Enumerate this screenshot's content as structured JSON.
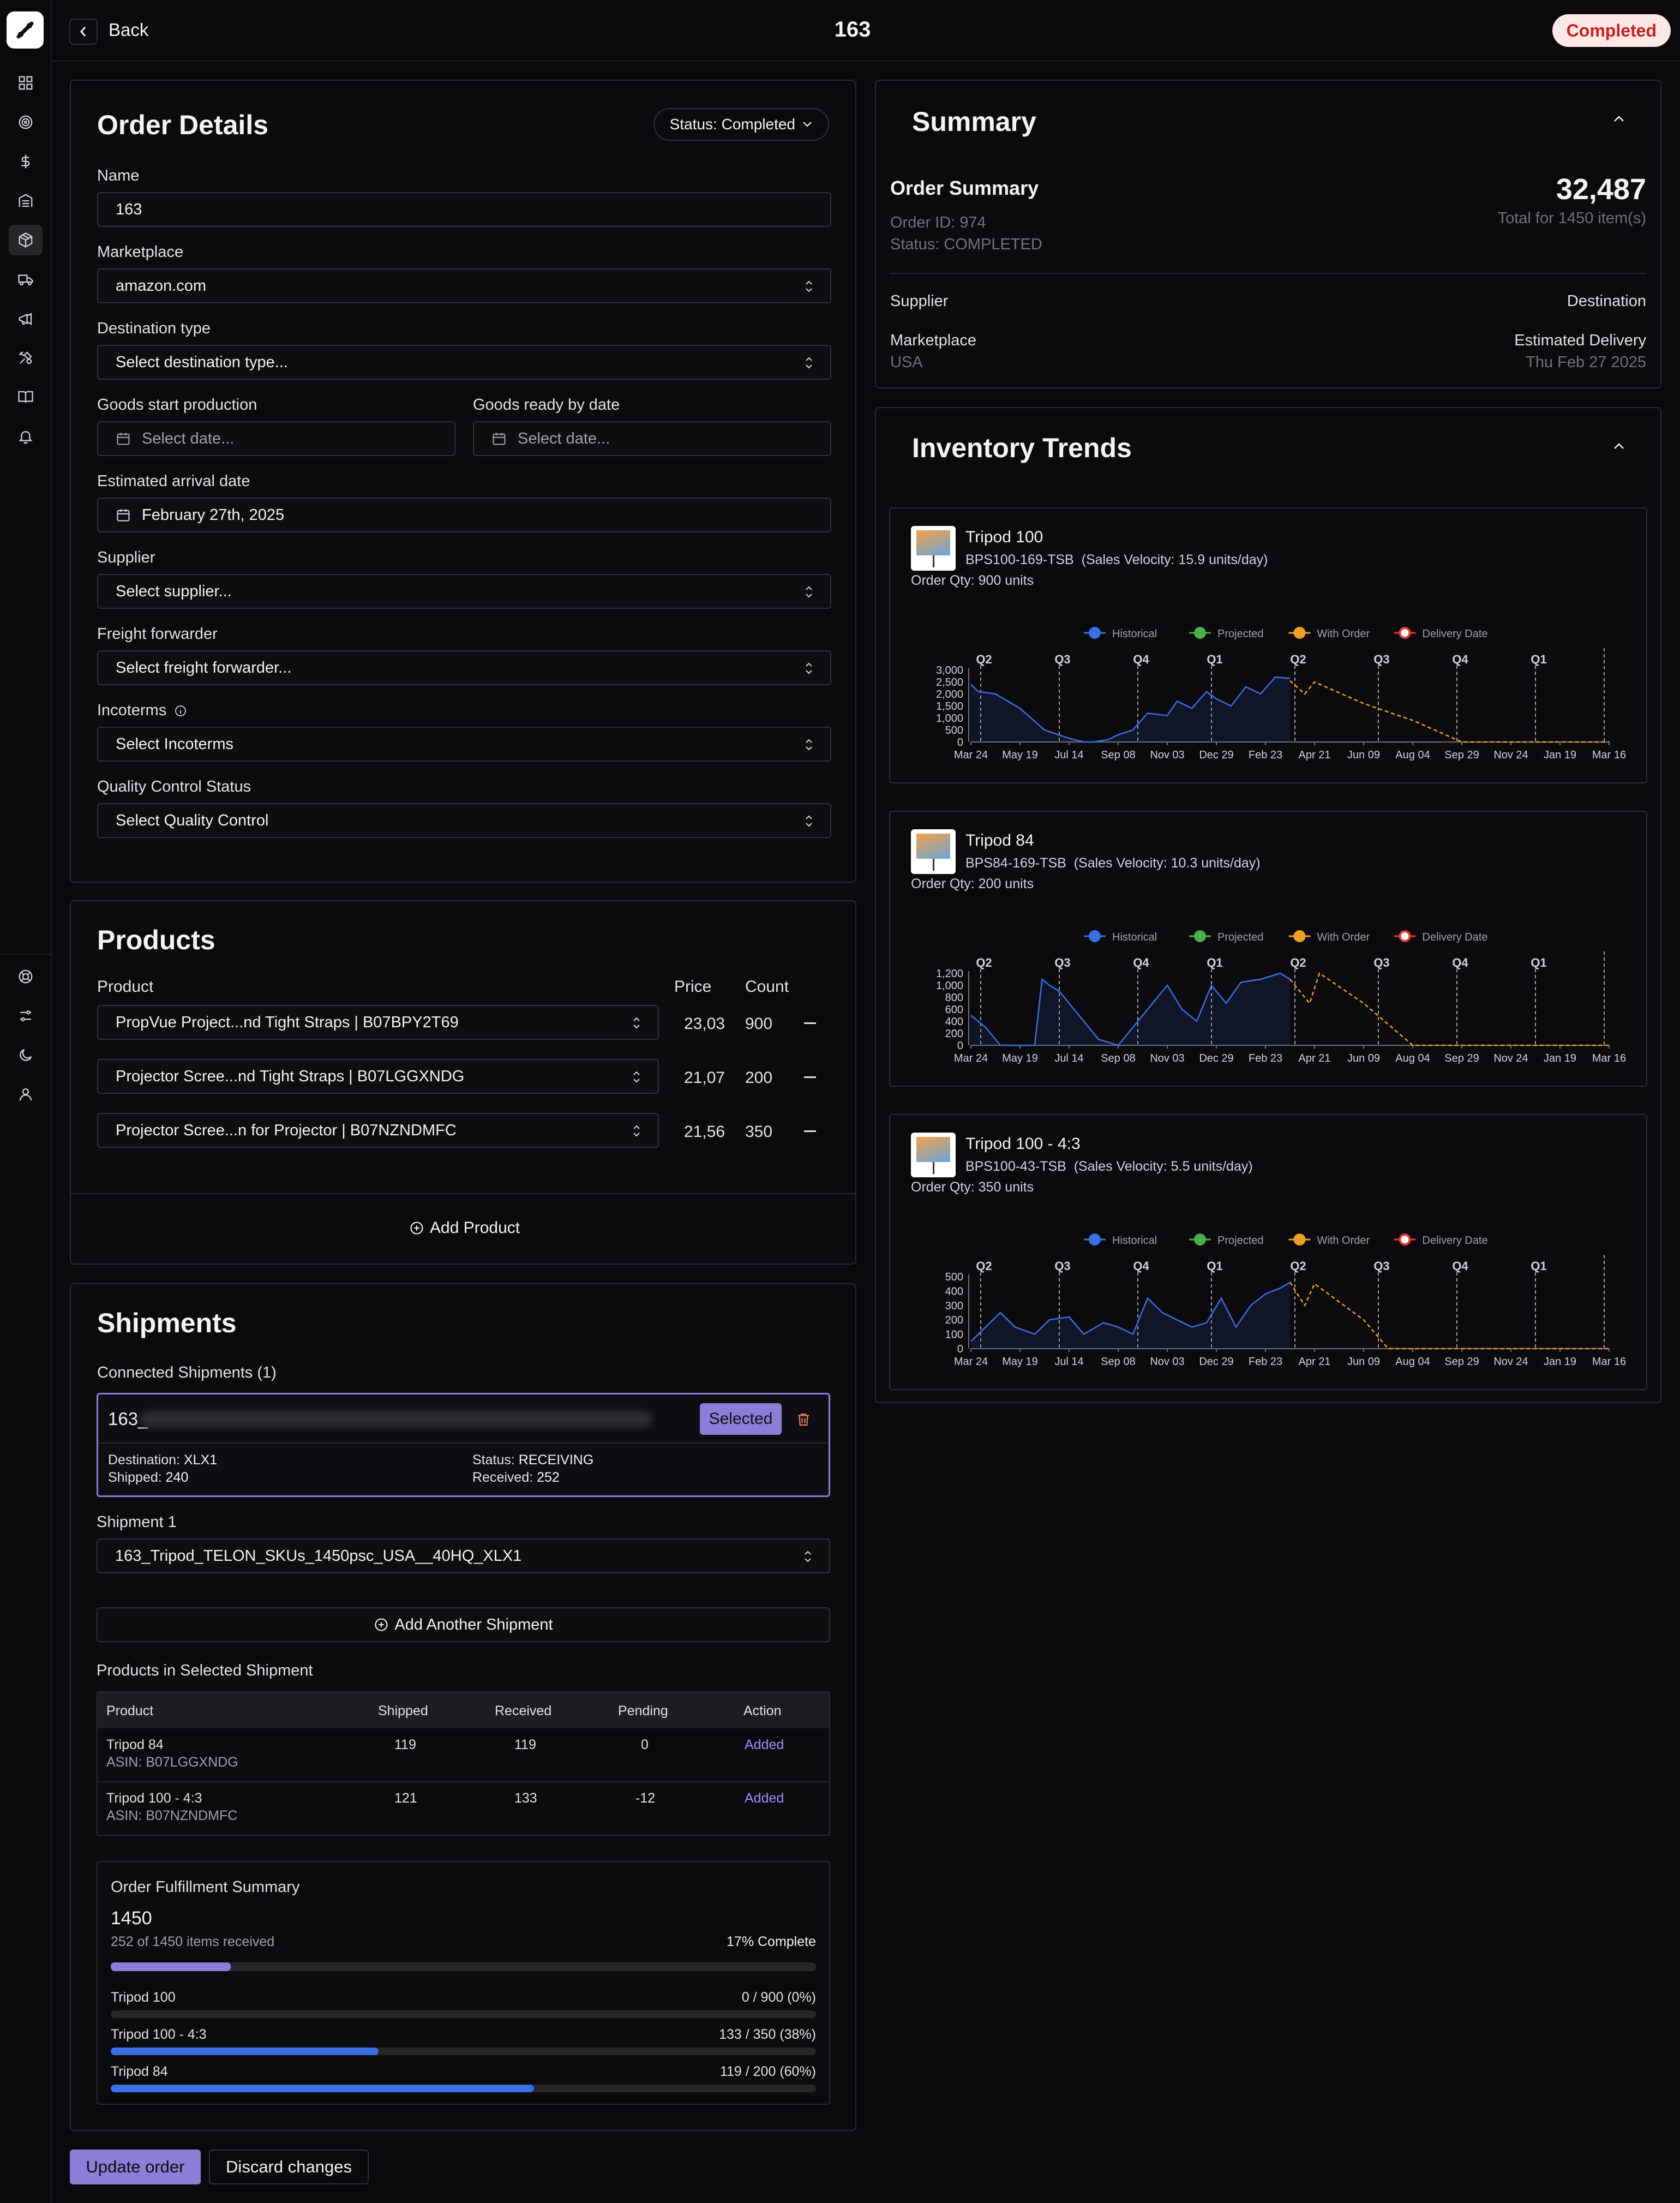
{
  "header": {
    "back_label": "Back",
    "title": "163",
    "status_badge": "Completed"
  },
  "colors": {
    "accent": "#8b7ed8",
    "historical": "#3b6fe6",
    "projected": "#4caf50",
    "with_order": "#f0a020",
    "delivery_date": "#e53935",
    "completed_badge_bg": "#fde8e6",
    "completed_badge_text": "#c5221f"
  },
  "sidebar": {
    "icons": [
      "dashboard-icon",
      "target-icon",
      "dollar-icon",
      "warehouse-icon",
      "package-icon",
      "truck-icon",
      "megaphone-icon",
      "tools-icon",
      "book-icon",
      "bell-icon",
      "lifebuoy-icon",
      "sliders-icon",
      "moon-icon",
      "user-icon"
    ],
    "active": "package-icon"
  },
  "order_details": {
    "title": "Order Details",
    "status_pill": "Status: Completed",
    "name_label": "Name",
    "name_value": "163",
    "marketplace_label": "Marketplace",
    "marketplace_value": "amazon.com",
    "destination_type_label": "Destination type",
    "destination_type_placeholder": "Select destination type...",
    "goods_start_label": "Goods start production",
    "goods_start_placeholder": "Select date...",
    "goods_ready_label": "Goods ready by date",
    "goods_ready_placeholder": "Select date...",
    "arrival_label": "Estimated arrival date",
    "arrival_value": "February 27th, 2025",
    "supplier_label": "Supplier",
    "supplier_placeholder": "Select supplier...",
    "freight_label": "Freight forwarder",
    "freight_placeholder": "Select freight forwarder...",
    "incoterms_label": "Incoterms",
    "incoterms_placeholder": "Select Incoterms",
    "qc_label": "Quality Control Status",
    "qc_placeholder": "Select Quality Control"
  },
  "products": {
    "title": "Products",
    "col_product": "Product",
    "col_price": "Price",
    "col_count": "Count",
    "rows": [
      {
        "product": "PropVue Project...nd Tight Straps | B07BPY2T69",
        "price": "23,03",
        "count": "900"
      },
      {
        "product": "Projector Scree...nd Tight Straps | B07LGGXNDG",
        "price": "21,07",
        "count": "200"
      },
      {
        "product": "Projector Scree...n for Projector | B07NZNDMFC",
        "price": "21,56",
        "count": "350"
      }
    ],
    "add_label": "Add Product"
  },
  "shipments": {
    "title": "Shipments",
    "connected_label": "Connected Shipments (1)",
    "connected": {
      "name_prefix": "163_",
      "selected_label": "Selected",
      "destination_label": "Destination:",
      "destination": "XLX1",
      "shipped_label": "Shipped:",
      "shipped": "240",
      "status_label": "Status:",
      "status": "RECEIVING",
      "received_label": "Received:",
      "received": "252"
    },
    "shipment1_label": "Shipment 1",
    "shipment1_value": "163_Tripod_TELON_SKUs_1450psc_USA__40HQ_XLX1",
    "add_label": "Add Another Shipment",
    "products_label": "Products in Selected Shipment",
    "table_headers": [
      "Product",
      "Shipped",
      "Received",
      "Pending",
      "Action"
    ],
    "table_rows": [
      {
        "name": "Tripod 84",
        "asin": "ASIN: B07LGGXNDG",
        "shipped": "119",
        "received": "119",
        "pending": "0",
        "action": "Added"
      },
      {
        "name": "Tripod 100 - 4:3",
        "asin": "ASIN: B07NZNDMFC",
        "shipped": "121",
        "received": "133",
        "pending": "-12",
        "action": "Added"
      }
    ],
    "fulfillment": {
      "title": "Order Fulfillment Summary",
      "total": "1450",
      "received_text": "252 of 1450 items received",
      "complete_text": "17% Complete",
      "overall_fraction": 0.17,
      "items": [
        {
          "name": "Tripod 100",
          "value_text": "0 / 900 (0%)",
          "fraction": 0.0
        },
        {
          "name": "Tripod 100 - 4:3",
          "value_text": "133 / 350 (38%)",
          "fraction": 0.38
        },
        {
          "name": "Tripod 84",
          "value_text": "119 / 200 (60%)",
          "fraction": 0.6
        }
      ]
    }
  },
  "actions": {
    "update_label": "Update order",
    "discard_label": "Discard changes"
  },
  "summary": {
    "title": "Summary",
    "order_summary_label": "Order Summary",
    "order_id": "Order ID: 974",
    "status": "Status: COMPLETED",
    "total_value": "32,487",
    "total_caption": "Total for 1450 item(s)",
    "supplier_label": "Supplier",
    "destination_label": "Destination",
    "marketplace_label": "Marketplace",
    "marketplace_value": "USA",
    "delivery_label": "Estimated Delivery",
    "delivery_value": "Thu Feb 27 2025"
  },
  "inventory": {
    "title": "Inventory Trends",
    "items": [
      {
        "name": "Tripod 100",
        "sku": "BPS100-169-TSB",
        "velocity": "(Sales Velocity: 15.9 units/day)",
        "order_qty": "Order Qty: 900 units"
      },
      {
        "name": "Tripod 84",
        "sku": "BPS84-169-TSB",
        "velocity": "(Sales Velocity: 10.3 units/day)",
        "order_qty": "Order Qty: 200 units"
      },
      {
        "name": "Tripod 100 - 4:3",
        "sku": "BPS100-43-TSB",
        "velocity": "(Sales Velocity: 5.5 units/day)",
        "order_qty": "Order Qty: 350 units"
      }
    ]
  },
  "chart_data": [
    {
      "type": "line",
      "legend": [
        "Historical",
        "Projected",
        "With Order",
        "Delivery Date"
      ],
      "legend_position": "top-center",
      "x_ticks": [
        "Mar 24",
        "May 19",
        "Jul 14",
        "Sep 08",
        "Nov 03",
        "Dec 29",
        "Feb 23",
        "Apr 21",
        "Jun 09",
        "Aug 04",
        "Sep 29",
        "Nov 24",
        "Jan 19",
        "Mar 16"
      ],
      "y_ticks": [
        "3,000",
        "2,500",
        "2,000",
        "1,500",
        "1,000",
        "500",
        "0"
      ],
      "ylim": [
        0,
        3000
      ],
      "quarter_markers": [
        "Q2",
        "Q3",
        "Q4",
        "Q1",
        "Q2",
        "Q3",
        "Q4",
        "Q1"
      ],
      "series": [
        {
          "name": "Historical",
          "x": [
            0,
            0.15,
            0.5,
            1.0,
            1.5,
            2.0,
            2.3,
            2.5,
            2.8,
            3.0,
            3.3,
            3.6,
            4.0,
            4.2,
            4.5,
            4.8,
            5.0,
            5.3,
            5.6,
            5.9,
            6.2,
            6.5
          ],
          "y": [
            2400,
            2100,
            2000,
            1400,
            500,
            150,
            0,
            0,
            100,
            300,
            500,
            1200,
            1100,
            1700,
            1400,
            2100,
            1800,
            1500,
            2300,
            2000,
            2700,
            2650
          ]
        },
        {
          "name": "With Order",
          "x": [
            6.5,
            6.8,
            7.0,
            8.0,
            9.0,
            10.0,
            11.0,
            12.0,
            13.0
          ],
          "y": [
            2550,
            2000,
            2500,
            1600,
            900,
            0,
            0,
            0,
            0
          ]
        }
      ]
    },
    {
      "type": "line",
      "legend": [
        "Historical",
        "Projected",
        "With Order",
        "Delivery Date"
      ],
      "legend_position": "top-center",
      "x_ticks": [
        "Mar 24",
        "May 19",
        "Jul 14",
        "Sep 08",
        "Nov 03",
        "Dec 29",
        "Feb 23",
        "Apr 21",
        "Jun 09",
        "Aug 04",
        "Sep 29",
        "Nov 24",
        "Jan 19",
        "Mar 16"
      ],
      "y_ticks": [
        "1,200",
        "1,000",
        "800",
        "600",
        "400",
        "200",
        "0"
      ],
      "ylim": [
        0,
        1200
      ],
      "quarter_markers": [
        "Q2",
        "Q3",
        "Q4",
        "Q1",
        "Q2",
        "Q3",
        "Q4",
        "Q1"
      ],
      "series": [
        {
          "name": "Historical",
          "x": [
            0,
            0.3,
            0.6,
            1.0,
            1.3,
            1.45,
            1.6,
            1.8,
            2.2,
            2.6,
            3.0,
            3.2,
            3.5,
            3.8,
            4.0,
            4.3,
            4.6,
            4.9,
            5.2,
            5.5,
            5.9,
            6.3,
            6.5
          ],
          "y": [
            500,
            300,
            0,
            0,
            0,
            1100,
            1000,
            900,
            500,
            100,
            0,
            200,
            500,
            800,
            1000,
            600,
            400,
            1000,
            700,
            1050,
            1100,
            1200,
            1100
          ]
        },
        {
          "name": "With Order",
          "x": [
            6.5,
            6.9,
            7.1,
            8.0,
            9.0,
            10.0,
            11.0,
            12.0,
            13.0
          ],
          "y": [
            1100,
            700,
            1200,
            700,
            0,
            0,
            0,
            0,
            0
          ]
        }
      ]
    },
    {
      "type": "line",
      "legend": [
        "Historical",
        "Projected",
        "With Order",
        "Delivery Date"
      ],
      "legend_position": "top-center",
      "x_ticks": [
        "Mar 24",
        "May 19",
        "Jul 14",
        "Sep 08",
        "Nov 03",
        "Dec 29",
        "Feb 23",
        "Apr 21",
        "Jun 09",
        "Aug 04",
        "Sep 29",
        "Nov 24",
        "Jan 19",
        "Mar 16"
      ],
      "y_ticks": [
        "500",
        "400",
        "300",
        "200",
        "100",
        "0"
      ],
      "ylim": [
        0,
        500
      ],
      "quarter_markers": [
        "Q2",
        "Q3",
        "Q4",
        "Q1",
        "Q2",
        "Q3",
        "Q4",
        "Q1"
      ],
      "series": [
        {
          "name": "Historical",
          "x": [
            0,
            0.3,
            0.6,
            0.9,
            1.3,
            1.6,
            2.0,
            2.3,
            2.7,
            3.0,
            3.3,
            3.6,
            3.9,
            4.2,
            4.5,
            4.8,
            5.1,
            5.4,
            5.7,
            6.0,
            6.3,
            6.5
          ],
          "y": [
            50,
            150,
            250,
            150,
            100,
            200,
            220,
            100,
            180,
            150,
            100,
            350,
            250,
            200,
            150,
            180,
            350,
            150,
            300,
            380,
            420,
            460
          ]
        },
        {
          "name": "With Order",
          "x": [
            6.5,
            6.8,
            7.0,
            8.0,
            8.5,
            9.0,
            10.0,
            11.0,
            12.0,
            13.0
          ],
          "y": [
            460,
            300,
            450,
            200,
            0,
            0,
            0,
            0,
            0,
            0
          ]
        }
      ]
    }
  ]
}
